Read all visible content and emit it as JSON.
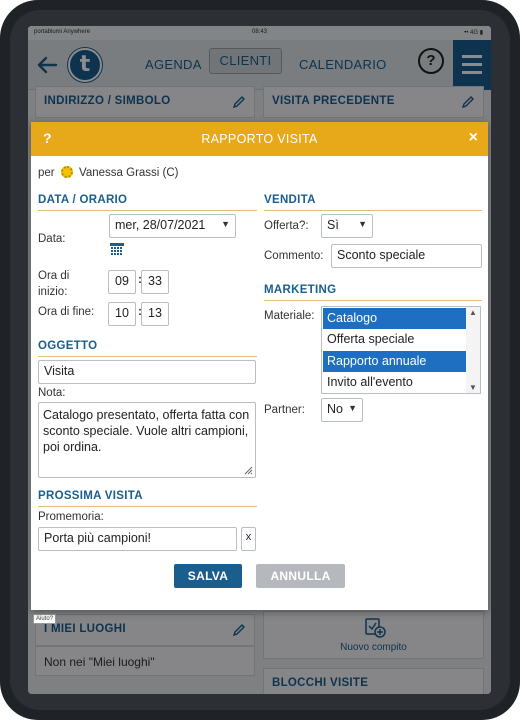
{
  "statusbar": {
    "left": "portablumi Anywhere",
    "center": "08:43",
    "right": "•• 4G ▮"
  },
  "nav": {
    "agenda": "AGENDA",
    "clienti": "CLIENTI",
    "calendario": "CALENDARIO",
    "help": "?",
    "logo": "t"
  },
  "bg_cards": {
    "address": "INDIRIZZO / SIMBOLO",
    "previous_visit": "VISITA PRECEDENTE",
    "my_places": "I MIEI LUOGHI",
    "my_places_value": "Non nei \"Miei luoghi\"",
    "new_task": "Nuovo compito",
    "blocks": "BLOCCHI VISITE",
    "help_tag": "Aiuto?"
  },
  "modal": {
    "help": "?",
    "title": "RAPPORTO VISITA",
    "close": "×",
    "for_prefix": "per",
    "customer": "Vanessa Grassi (C)",
    "date_section": "DATA / ORARIO",
    "date_label": "Data:",
    "date_value": "mer, 28/07/2021",
    "start_label_1": "Ora di",
    "start_label_2": "inizio:",
    "start_hour": "09",
    "start_min": "33",
    "end_label": "Ora di fine:",
    "end_hour": "10",
    "end_min": "13",
    "time_sep": ":",
    "subject_section": "OGGETTO",
    "subject_value": "Visita",
    "note_label": "Nota:",
    "note_value": "Catalogo presentato, offerta fatta con sconto speciale. Vuole altri campioni, poi ordina.",
    "next_section": "PROSSIMA VISITA",
    "reminder_label": "Promemoria:",
    "reminder_value": "Porta più campioni!",
    "reminder_clear": "x",
    "sale_section": "VENDITA",
    "offer_label": "Offerta?:",
    "offer_value": "Sì",
    "comment_label": "Commento:",
    "comment_value": "Sconto speciale",
    "marketing_section": "MARKETING",
    "material_label": "Materiale:",
    "materials": [
      "Catalogo",
      "Offerta speciale",
      "Rapporto annuale",
      "Invito all'evento"
    ],
    "partner_label": "Partner:",
    "partner_value": "No",
    "save": "SALVA",
    "cancel": "ANNULLA"
  },
  "colors": {
    "accent": "#1a5e8e",
    "header": "#e7a91a",
    "selection": "#1e6fc2"
  }
}
